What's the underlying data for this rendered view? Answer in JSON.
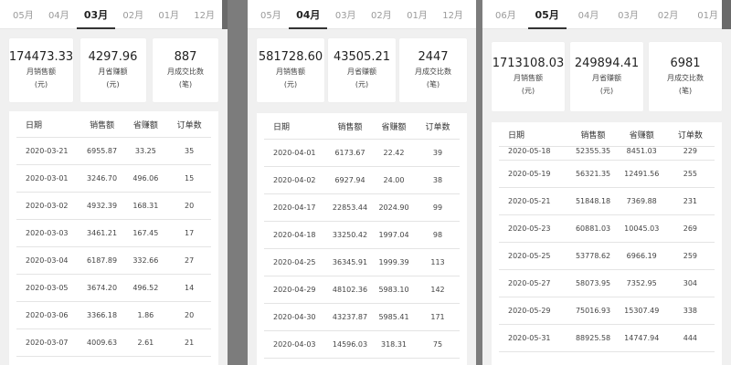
{
  "panels": [
    {
      "tabs": [
        "05月",
        "04月",
        "03月",
        "02月",
        "01月",
        "12月"
      ],
      "active_tab": 2,
      "stats": [
        {
          "value": "174473.33",
          "label1": "月销售额",
          "label2": "(元)"
        },
        {
          "value": "4297.96",
          "label1": "月省赚额",
          "label2": "(元)"
        },
        {
          "value": "887",
          "label1": "月成交比数",
          "label2": "(笔)"
        }
      ],
      "table": {
        "headers": [
          "日期",
          "销售额",
          "省赚额",
          "订单数"
        ],
        "rows": [
          [
            "2020-03-21",
            "6955.87",
            "33.25",
            "35"
          ],
          [
            "2020-03-01",
            "3246.70",
            "496.06",
            "15"
          ],
          [
            "2020-03-02",
            "4932.39",
            "168.31",
            "20"
          ],
          [
            "2020-03-03",
            "3461.21",
            "167.45",
            "17"
          ],
          [
            "2020-03-04",
            "6187.89",
            "332.66",
            "27"
          ],
          [
            "2020-03-05",
            "3674.20",
            "496.52",
            "14"
          ],
          [
            "2020-03-06",
            "3366.18",
            "1.86",
            "20"
          ],
          [
            "2020-03-07",
            "4009.63",
            "2.61",
            "21"
          ]
        ]
      }
    },
    {
      "tabs": [
        "05月",
        "04月",
        "03月",
        "02月",
        "01月",
        "12月"
      ],
      "active_tab": 1,
      "stats": [
        {
          "value": "581728.60",
          "label1": "月销售额",
          "label2": "(元)"
        },
        {
          "value": "43505.21",
          "label1": "月省赚额",
          "label2": "(元)"
        },
        {
          "value": "2447",
          "label1": "月成交比数",
          "label2": "(笔)"
        }
      ],
      "table": {
        "headers": [
          "日期",
          "销售额",
          "省赚额",
          "订单数"
        ],
        "rows": [
          [
            "2020-04-01",
            "6173.67",
            "22.42",
            "39"
          ],
          [
            "2020-04-02",
            "6927.94",
            "24.00",
            "38"
          ],
          [
            "2020-04-17",
            "22853.44",
            "2024.90",
            "99"
          ],
          [
            "2020-04-18",
            "33250.42",
            "1997.04",
            "98"
          ],
          [
            "2020-04-25",
            "36345.91",
            "1999.39",
            "113"
          ],
          [
            "2020-04-29",
            "48102.36",
            "5983.10",
            "142"
          ],
          [
            "2020-04-30",
            "43237.87",
            "5985.41",
            "171"
          ],
          [
            "2020-04-03",
            "14596.03",
            "318.31",
            "75"
          ]
        ]
      }
    },
    {
      "tabs": [
        "06月",
        "05月",
        "04月",
        "03月",
        "02月",
        "01月"
      ],
      "active_tab": 1,
      "stats": [
        {
          "value": "1713108.03",
          "label1": "月销售额",
          "label2": "(元)"
        },
        {
          "value": "249894.41",
          "label1": "月省赚额",
          "label2": "(元)"
        },
        {
          "value": "6981",
          "label1": "月成交比数",
          "label2": "(笔)"
        }
      ],
      "table": {
        "headers": [
          "日期",
          "销售额",
          "省赚额",
          "订单数"
        ],
        "rows": [
          [
            "2020-05-18",
            "52355.35",
            "8451.03",
            "229"
          ],
          [
            "2020-05-19",
            "56321.35",
            "12491.56",
            "255"
          ],
          [
            "2020-05-21",
            "51848.18",
            "7369.88",
            "231"
          ],
          [
            "2020-05-23",
            "60881.03",
            "10045.03",
            "269"
          ],
          [
            "2020-05-25",
            "53778.62",
            "6966.19",
            "259"
          ],
          [
            "2020-05-27",
            "58073.95",
            "7352.95",
            "304"
          ],
          [
            "2020-05-29",
            "75016.93",
            "15307.49",
            "338"
          ],
          [
            "2020-05-31",
            "88925.58",
            "14747.94",
            "444"
          ]
        ]
      }
    }
  ]
}
